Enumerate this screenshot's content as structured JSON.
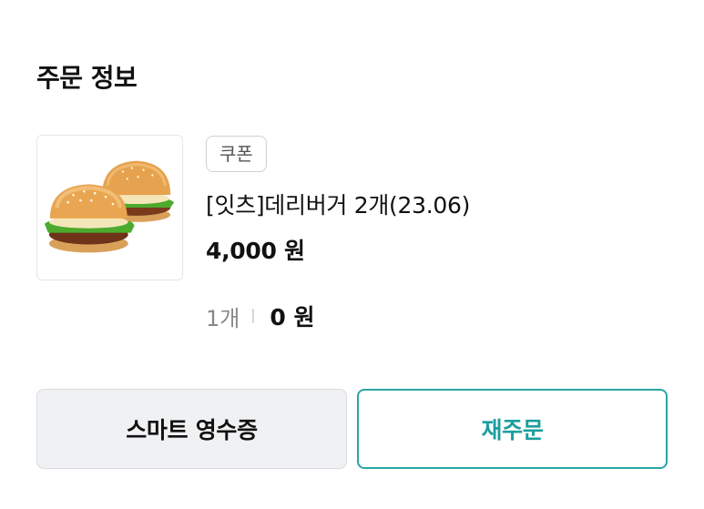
{
  "order_info": {
    "title": "주문 정보"
  },
  "item": {
    "badge": "쿠폰",
    "name": "[잇츠]데리버거 2개(23.06)",
    "price": "4,000 원",
    "quantity": "1개",
    "amount": "0 원",
    "image_icon": "burger-image"
  },
  "actions": {
    "receipt_label": "스마트 영수증",
    "reorder_label": "재주문"
  },
  "colors": {
    "accent": "#2aa6a6",
    "secondary_bg": "#f0f1f3"
  }
}
